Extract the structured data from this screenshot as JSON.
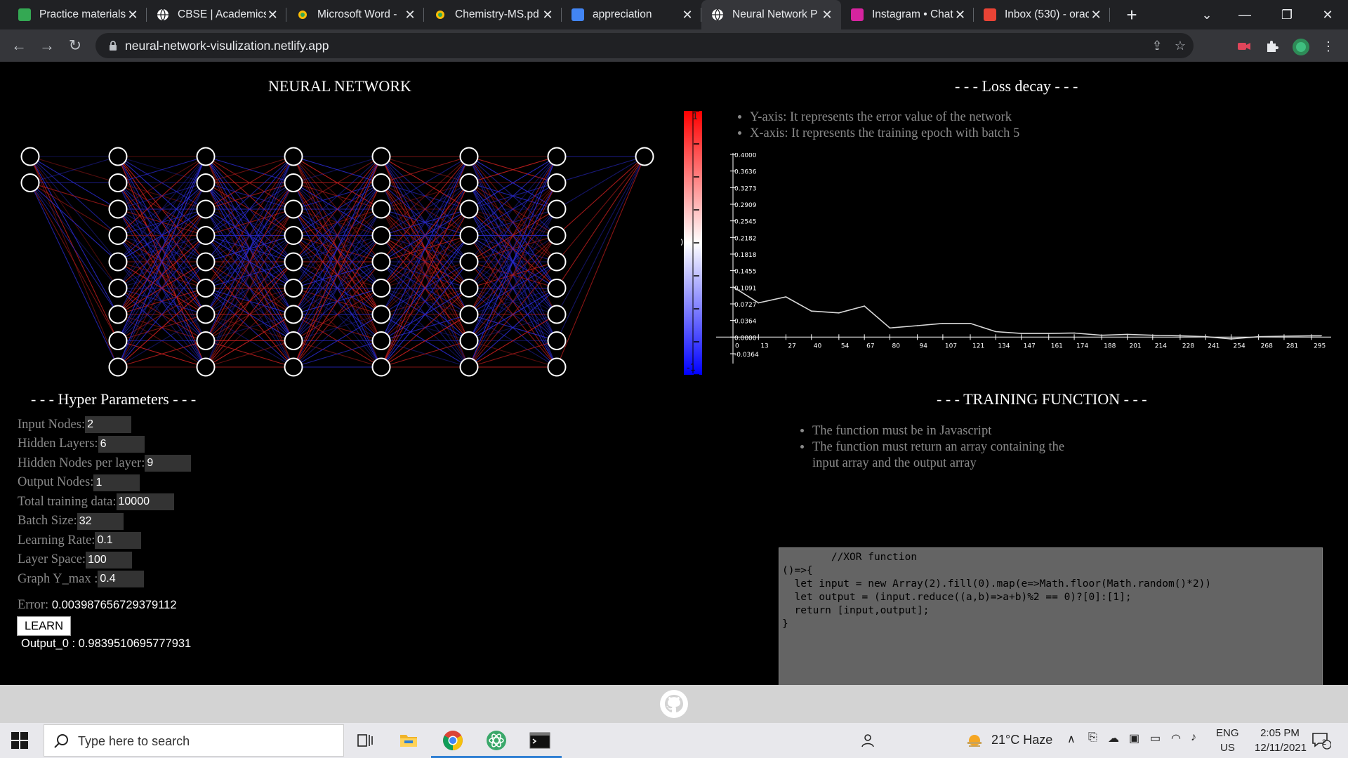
{
  "browser": {
    "tabs": [
      {
        "title": "Practice materials",
        "favicon": "green",
        "active": false
      },
      {
        "title": "CBSE | Academics",
        "favicon": "globe",
        "active": false
      },
      {
        "title": "Microsoft Word -",
        "favicon": "yellow-circle",
        "active": false
      },
      {
        "title": "Chemistry-MS.pd",
        "favicon": "yellow-circle",
        "active": false
      },
      {
        "title": "appreciation",
        "favicon": "google-meet",
        "active": false
      },
      {
        "title": "Neural Network P",
        "favicon": "globe",
        "active": true
      },
      {
        "title": "Instagram • Chats",
        "favicon": "instagram",
        "active": false
      },
      {
        "title": "Inbox (530) - orac",
        "favicon": "gmail",
        "active": false
      }
    ],
    "url": "neural-network-visulization.netlify.app"
  },
  "network": {
    "title": "NEURAL NETWORK",
    "layers": [
      2,
      9,
      9,
      9,
      9,
      9,
      9,
      1
    ]
  },
  "loss": {
    "title": "- - - Loss decay - - -",
    "notes": [
      "Y-axis: It represents the error value of the network",
      "X-axis: It represents the training epoch with batch 5"
    ],
    "colorbar": {
      "top_label": "1",
      "mid_label": "0",
      "bottom_label": "-1"
    }
  },
  "chart_data": {
    "type": "line",
    "title": "",
    "xlabel": "",
    "ylabel": "",
    "ylim": [
      -0.0364,
      0.4
    ],
    "y_ticks": [
      "0.4000",
      "0.3636",
      "0.3273",
      "0.2909",
      "0.2545",
      "0.2182",
      "0.1818",
      "0.1455",
      "0.1091",
      "0.0727",
      "0.0364",
      "0.0000",
      "-0.0364"
    ],
    "x_ticks": [
      "0",
      "13",
      "27",
      "40",
      "54",
      "67",
      "80",
      "94",
      "107",
      "121",
      "134",
      "147",
      "161",
      "174",
      "188",
      "201",
      "214",
      "228",
      "241",
      "254",
      "268",
      "281",
      "295"
    ],
    "x": [
      0,
      13,
      27,
      40,
      54,
      67,
      80,
      94,
      107,
      121,
      134,
      147,
      161,
      174,
      188,
      201,
      214,
      228,
      241,
      254,
      268,
      281,
      295,
      300
    ],
    "y": [
      0.11,
      0.075,
      0.088,
      0.057,
      0.053,
      0.068,
      0.02,
      0.025,
      0.03,
      0.03,
      0.012,
      0.008,
      0.008,
      0.009,
      0.004,
      0.006,
      0.004,
      0.003,
      0.001,
      -0.004,
      0.001,
      0.002,
      0.003,
      0.003
    ]
  },
  "hyper": {
    "title": "- - - Hyper Parameters - - -",
    "params": [
      {
        "label": "Input Nodes:",
        "value": "2"
      },
      {
        "label": "Hidden Layers:",
        "value": "6"
      },
      {
        "label": "Hidden Nodes per layer:",
        "value": "9"
      },
      {
        "label": "Output Nodes:",
        "value": "1"
      },
      {
        "label": "Total training data:",
        "value": "10000"
      },
      {
        "label": "Batch Size:",
        "value": "32"
      },
      {
        "label": "Learning Rate:",
        "value": "0.1"
      },
      {
        "label": "Layer Space:",
        "value": "100"
      },
      {
        "label": "Graph Y_max :",
        "value": "0.4"
      }
    ],
    "error_label": "Error:",
    "error_value": "0.003987656729379112",
    "learn_label": "LEARN",
    "output_text": "Output_0 : 0.9839510695777931"
  },
  "training": {
    "title": "- - - TRAINING FUNCTION - - -",
    "notes": [
      "The function must be in Javascript",
      "The function must return an array containing the input array and the output array"
    ],
    "code": "        //XOR function\n()=>{\n  let input = new Array(2).fill(0).map(e=>Math.floor(Math.random()*2))\n  let output = (input.reduce((a,b)=>a+b)%2 == 0)?[0]:[1];\n  return [input,output];\n}"
  },
  "taskbar": {
    "search_placeholder": "Type here to search",
    "weather": "21°C  Haze",
    "lang1": "ENG",
    "lang2": "US",
    "time": "2:05 PM",
    "date": "12/11/2021",
    "notif_count": "2"
  },
  "colors": {
    "positive_weight": "#c41e1e",
    "negative_weight": "#2a2ad0",
    "line": "#d8d8d8"
  }
}
